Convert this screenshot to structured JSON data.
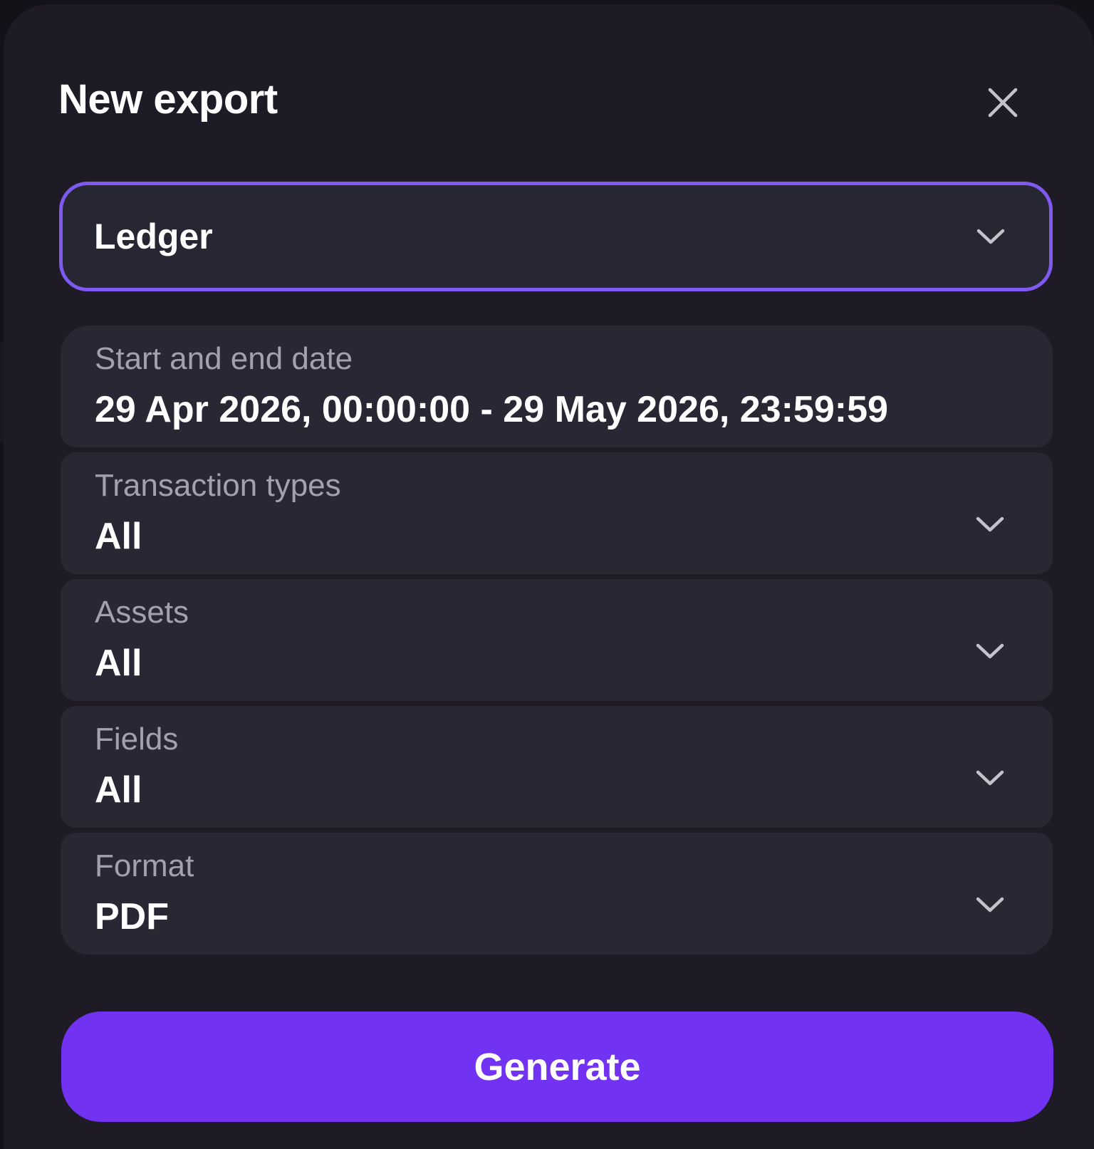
{
  "dialog": {
    "title": "New export",
    "close_icon": "close-icon"
  },
  "export_type": {
    "value": "Ledger",
    "icon": "chevron-down-icon",
    "focus_color": "#7f5af0"
  },
  "fields": [
    {
      "label": "Start and end date",
      "value": "29 Apr 2026, 00:00:00 - 29 May 2026, 23:59:59"
    },
    {
      "label": "Transaction types",
      "value": "All",
      "icon": "chevron-down-icon"
    },
    {
      "label": "Assets",
      "value": "All",
      "icon": "chevron-down-icon"
    },
    {
      "label": "Fields",
      "value": "All",
      "icon": "chevron-down-icon"
    },
    {
      "label": "Format",
      "value": "PDF",
      "icon": "chevron-down-icon"
    }
  ],
  "actions": {
    "generate_label": "Generate",
    "generate_color": "#7232f2"
  }
}
